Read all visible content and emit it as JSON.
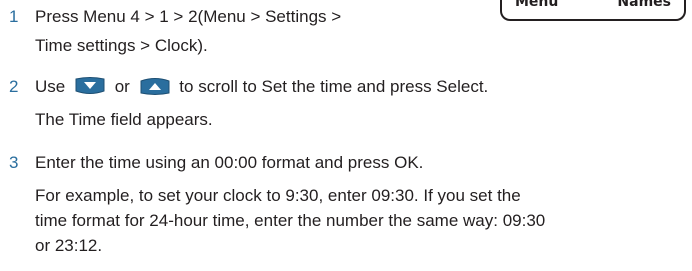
{
  "screen": {
    "left_softkey": "Menu",
    "right_softkey": "Names"
  },
  "steps": [
    {
      "number": "1",
      "line1": "Press Menu 4 > 1 > 2(Menu > Settings >",
      "line2": "Time settings > Clock)."
    },
    {
      "number": "2",
      "text_before": "Use",
      "text_between": "or",
      "text_after": "to scroll to Set the time and press Select.",
      "note": "The Time field appears.",
      "icons": [
        "scroll-down-key-icon",
        "scroll-up-key-icon"
      ]
    },
    {
      "number": "3",
      "text": "Enter the time using an 00:00 format and press OK.",
      "note_lines": [
        "For example, to set your clock to 9:30, enter 09:30. If you set the",
        "time format for 24-hour time, enter the number the same way: 09:30",
        "or 23:12."
      ]
    }
  ],
  "colors": {
    "step_number": "#2a6e9e",
    "body_text": "#231f20",
    "key_fill": "#2a6e9e"
  }
}
